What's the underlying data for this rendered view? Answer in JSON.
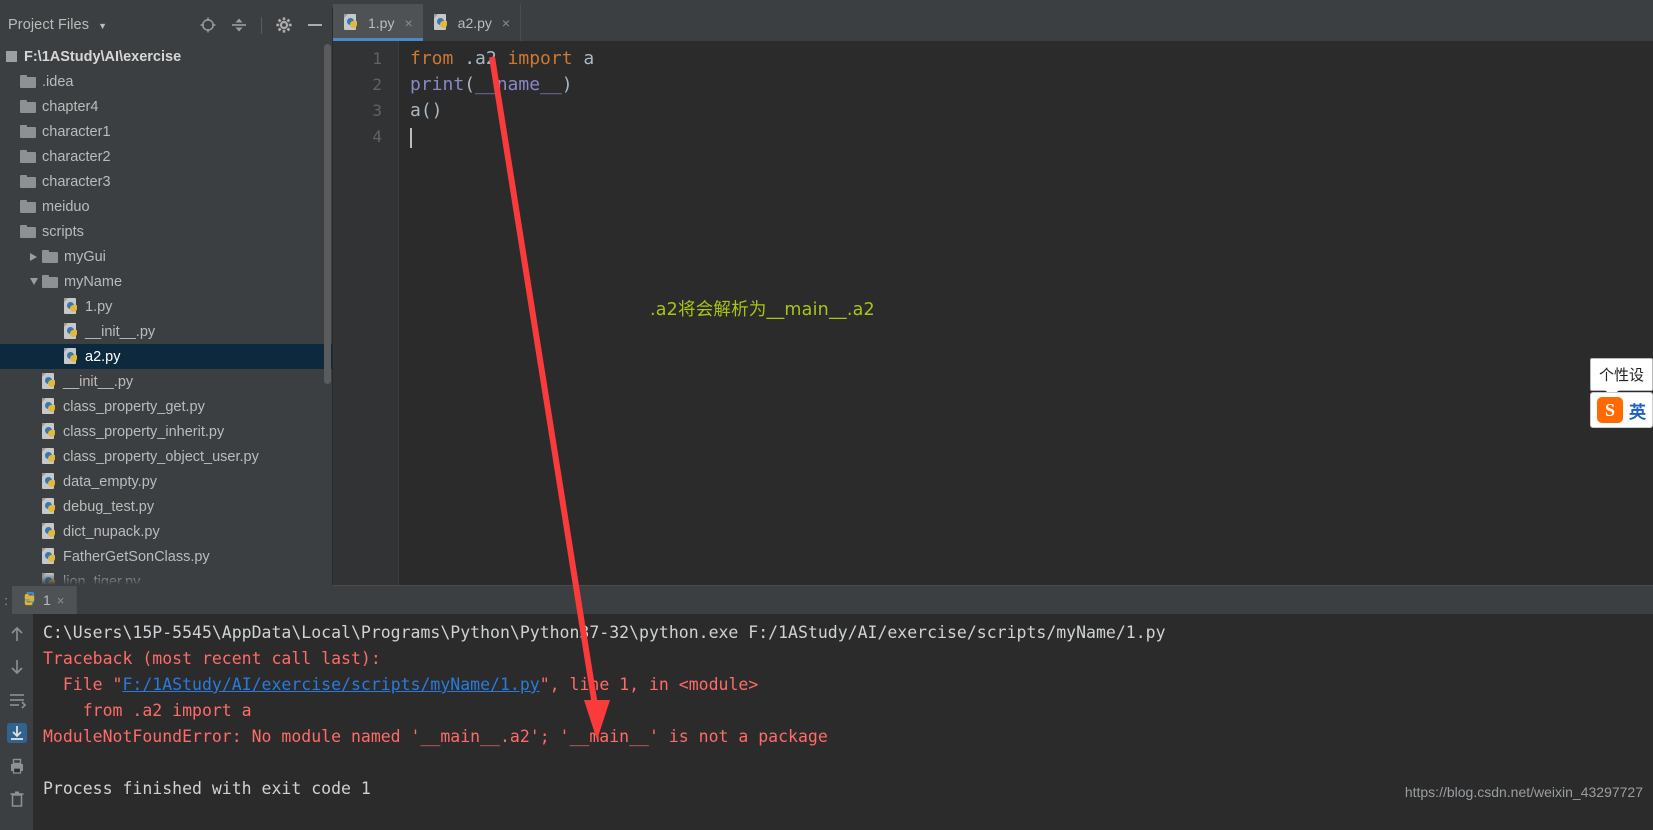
{
  "project_panel": {
    "title": "Project Files",
    "caret_icon": "chevron-down-icon",
    "actions": [
      {
        "name": "locate-icon",
        "label": "locate"
      },
      {
        "name": "collapse-all-icon",
        "label": "collapse all"
      },
      {
        "name": "gear-icon",
        "label": "settings"
      },
      {
        "name": "minimize-icon",
        "label": "hide"
      }
    ],
    "root": "F:\\1AStudy\\AI\\exercise",
    "tree": [
      {
        "label": ".idea",
        "type": "folder",
        "depth": 1,
        "arrow": "none",
        "selected": false
      },
      {
        "label": "chapter4",
        "type": "folder",
        "depth": 1,
        "arrow": "none",
        "selected": false
      },
      {
        "label": "character1",
        "type": "folder",
        "depth": 1,
        "arrow": "none",
        "selected": false
      },
      {
        "label": "character2",
        "type": "folder",
        "depth": 1,
        "arrow": "none",
        "selected": false
      },
      {
        "label": "character3",
        "type": "folder",
        "depth": 1,
        "arrow": "none",
        "selected": false
      },
      {
        "label": "meiduo",
        "type": "folder",
        "depth": 1,
        "arrow": "none",
        "selected": false
      },
      {
        "label": "scripts",
        "type": "folder",
        "depth": 1,
        "arrow": "none",
        "selected": false
      },
      {
        "label": "myGui",
        "type": "folder",
        "depth": 2,
        "arrow": "collapsed",
        "selected": false
      },
      {
        "label": "myName",
        "type": "folder",
        "depth": 2,
        "arrow": "expanded",
        "selected": false
      },
      {
        "label": "1.py",
        "type": "python",
        "depth": 3,
        "arrow": "none",
        "selected": false
      },
      {
        "label": "__init__.py",
        "type": "python",
        "depth": 3,
        "arrow": "none",
        "selected": false
      },
      {
        "label": "a2.py",
        "type": "python",
        "depth": 3,
        "arrow": "none",
        "selected": true
      },
      {
        "label": "__init__.py",
        "type": "python",
        "depth": 2,
        "arrow": "none",
        "selected": false
      },
      {
        "label": "class_property_get.py",
        "type": "python",
        "depth": 2,
        "arrow": "none",
        "selected": false
      },
      {
        "label": "class_property_inherit.py",
        "type": "python",
        "depth": 2,
        "arrow": "none",
        "selected": false
      },
      {
        "label": "class_property_object_user.py",
        "type": "python",
        "depth": 2,
        "arrow": "none",
        "selected": false
      },
      {
        "label": "data_empty.py",
        "type": "python",
        "depth": 2,
        "arrow": "none",
        "selected": false
      },
      {
        "label": "debug_test.py",
        "type": "python",
        "depth": 2,
        "arrow": "none",
        "selected": false
      },
      {
        "label": "dict_nupack.py",
        "type": "python",
        "depth": 2,
        "arrow": "none",
        "selected": false
      },
      {
        "label": "FatherGetSonClass.py",
        "type": "python",
        "depth": 2,
        "arrow": "none",
        "selected": false
      },
      {
        "label": "lion_tiger.py",
        "type": "python",
        "depth": 2,
        "arrow": "none",
        "selected": false
      }
    ]
  },
  "editor": {
    "tabs": [
      {
        "label": "1.py",
        "active": true,
        "icon": "python-file-icon",
        "close_icon": "×"
      },
      {
        "label": "a2.py",
        "active": false,
        "icon": "python-file-icon",
        "close_icon": "×"
      }
    ],
    "line_numbers": [
      "1",
      "2",
      "3",
      "4"
    ],
    "code_lines": [
      [
        {
          "t": "from",
          "c": "kw"
        },
        {
          "t": " .a2 ",
          "c": "plain"
        },
        {
          "t": "import",
          "c": "kw"
        },
        {
          "t": " a",
          "c": "plain"
        }
      ],
      [
        {
          "t": "print",
          "c": "fn"
        },
        {
          "t": "(",
          "c": "plain"
        },
        {
          "t": "__name__",
          "c": "dunder"
        },
        {
          "t": ")",
          "c": "plain"
        }
      ],
      [
        {
          "t": "a()",
          "c": "plain"
        }
      ],
      []
    ],
    "annotation": ".a2将会解析为__main__.a2",
    "annotation_color": "#a6c516",
    "arrow_color": "#fb3b3b"
  },
  "console": {
    "tab_label": "1",
    "tab_icon": "python-run-icon",
    "tab_close_icon": "×",
    "gutter_prefix": ":",
    "toolbar_icons": [
      {
        "name": "up-arrow-icon"
      },
      {
        "name": "down-arrow-icon"
      },
      {
        "name": "soft-wrap-icon"
      },
      {
        "name": "scroll-to-end-icon"
      },
      {
        "name": "print-icon"
      },
      {
        "name": "trash-icon"
      }
    ],
    "lines": [
      {
        "segments": [
          {
            "t": "C:\\Users\\15P-5545\\AppData\\Local\\Programs\\Python\\Python37-32\\python.exe F:/1AStudy/AI/exercise/scripts/myName/1.py",
            "c": "c-white"
          }
        ]
      },
      {
        "segments": [
          {
            "t": "Traceback (most recent call last):",
            "c": "c-err"
          }
        ]
      },
      {
        "segments": [
          {
            "t": "  File \"",
            "c": "c-err"
          },
          {
            "t": "F:/1AStudy/AI/exercise/scripts/myName/1.py",
            "c": "c-link"
          },
          {
            "t": "\", line 1, in <module>",
            "c": "c-err"
          }
        ]
      },
      {
        "segments": [
          {
            "t": "    from .a2 import a",
            "c": "c-err"
          }
        ]
      },
      {
        "segments": [
          {
            "t": "ModuleNotFoundError: No module named '__main__.a2'; '__main__' is not a package",
            "c": "c-err"
          }
        ]
      },
      {
        "segments": [
          {
            "t": "",
            "c": "c-err"
          }
        ]
      },
      {
        "segments": [
          {
            "t": "Process finished with exit code 1",
            "c": "c-white"
          }
        ]
      }
    ],
    "watermark": "https://blog.csdn.net/weixin_43297727"
  },
  "ime": {
    "tooltip": "个性设",
    "logo_letter": "S",
    "mode_label": "英"
  }
}
